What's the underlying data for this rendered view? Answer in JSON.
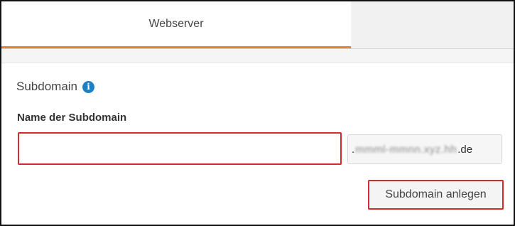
{
  "tabs": [
    {
      "label": "Webserver",
      "active": true
    }
  ],
  "section": {
    "title": "Subdomain",
    "info_icon": "info-circle-icon"
  },
  "form": {
    "field_label": "Name der Subdomain",
    "subdomain_value": "",
    "domain_prefix": ".",
    "domain_redacted": "mmml-mmnn.xyz.hh",
    "domain_suffix": ".de",
    "submit_label": "Subdomain anlegen"
  },
  "colors": {
    "accent_tab": "#e9822b",
    "info_icon": "#1f7fc4",
    "highlight_border": "#d42b2b"
  }
}
